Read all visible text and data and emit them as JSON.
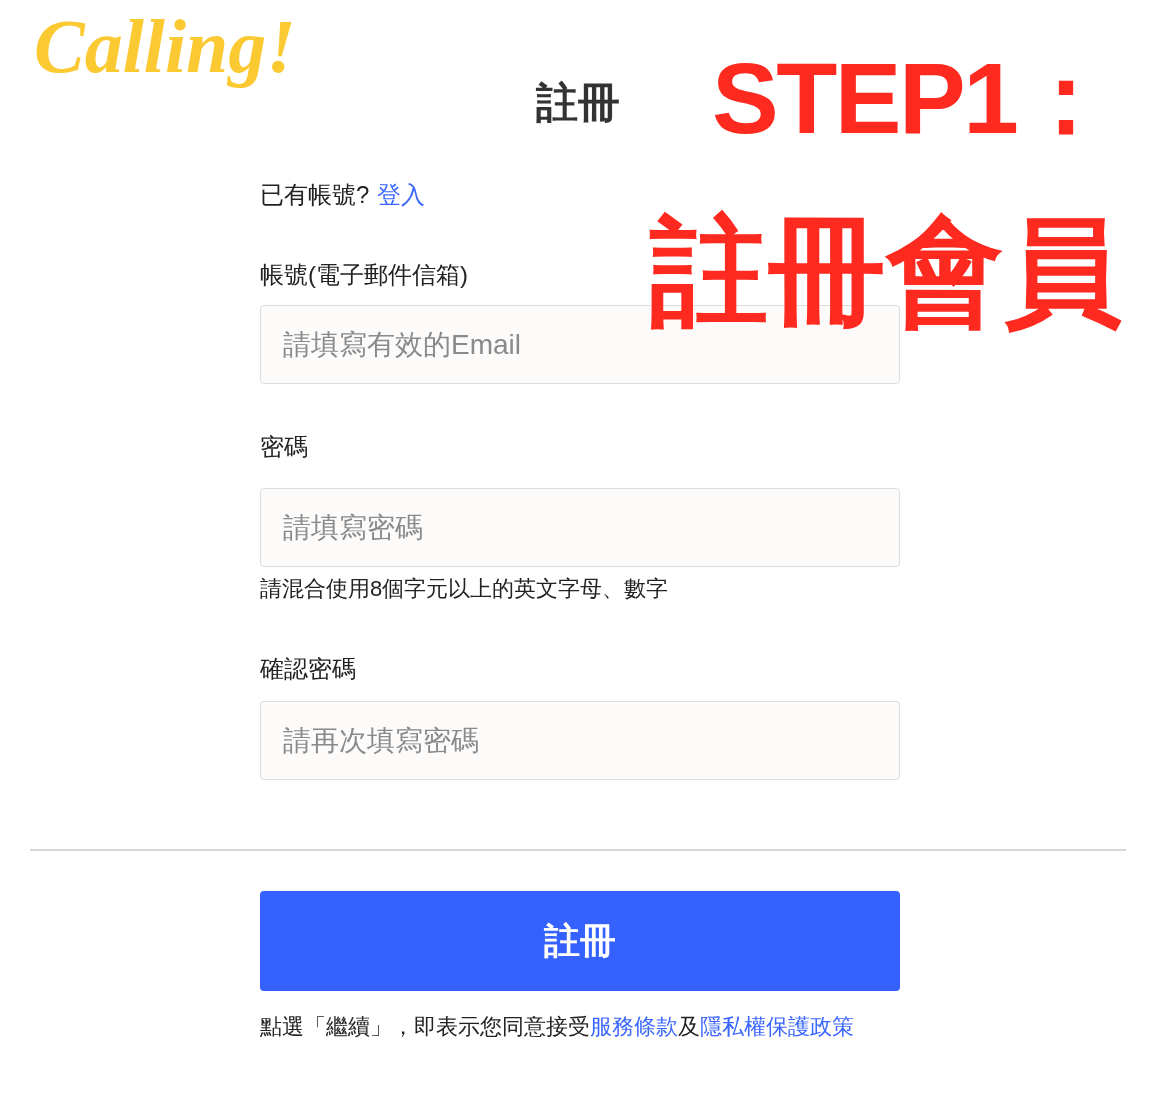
{
  "logo": {
    "text": "Calling!"
  },
  "title": "註冊",
  "annotation": {
    "step": "STEP1：",
    "caption": "註冊會員"
  },
  "login_prompt": {
    "text": "已有帳號?",
    "link": "登入"
  },
  "fields": [
    {
      "label": "帳號(電子郵件信箱)",
      "placeholder": "請填寫有效的Email"
    },
    {
      "label": "密碼",
      "placeholder": "請填寫密碼",
      "hint": "請混合使用8個字元以上的英文字母、數字"
    },
    {
      "label": "確認密碼",
      "placeholder": "請再次填寫密碼"
    }
  ],
  "submit_button": "註冊",
  "terms": {
    "prefix": "點選「繼續」，即表示您同意接受",
    "link1": "服務條款",
    "middle": "及",
    "link2": "隱私權保護政策"
  }
}
